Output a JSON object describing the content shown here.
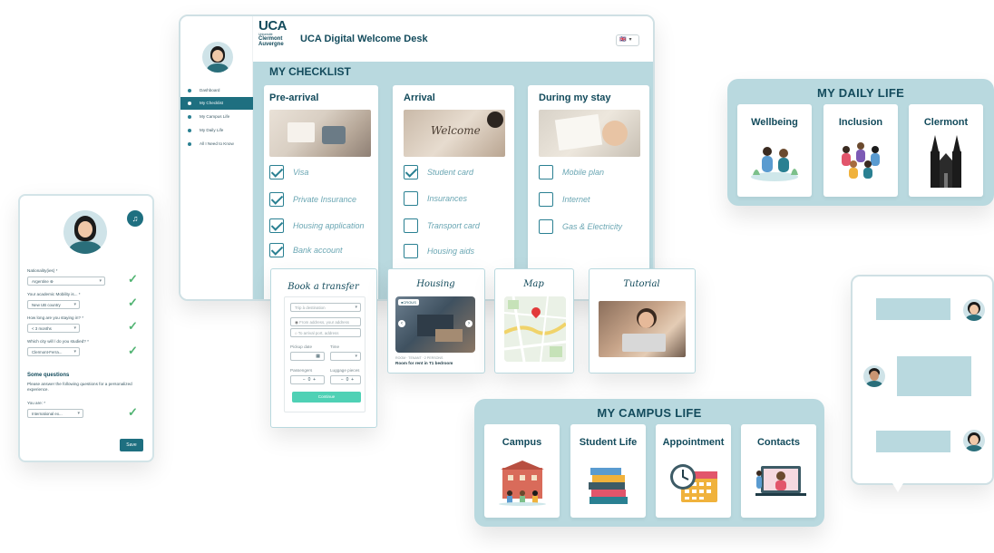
{
  "header": {
    "logo_text": "UCA",
    "logo_sub": [
      "Université",
      "Clermont",
      "Auvergne"
    ],
    "title": "UCA Digital Welcome Desk",
    "language": "🇬🇧"
  },
  "sidebar": {
    "items": [
      {
        "label": "Dashboard",
        "active": false
      },
      {
        "label": "My Checklist",
        "active": true
      },
      {
        "label": "My Campus Life",
        "active": false
      },
      {
        "label": "My Daily Life",
        "active": false
      },
      {
        "label": "All I Need to Know",
        "active": false
      }
    ]
  },
  "checklist": {
    "heading": "MY CHECKLIST",
    "columns": [
      {
        "title": "Pre-arrival",
        "items": [
          {
            "label": "Visa",
            "checked": true
          },
          {
            "label": "Private Insurance",
            "checked": true
          },
          {
            "label": "Housing application",
            "checked": true
          },
          {
            "label": "Bank account",
            "checked": true
          }
        ]
      },
      {
        "title": "Arrival",
        "image_text": "Welcome",
        "items": [
          {
            "label": "Student card",
            "checked": true
          },
          {
            "label": "Insurances",
            "checked": false
          },
          {
            "label": "Transport card",
            "checked": false
          },
          {
            "label": "Housing aids",
            "checked": false
          }
        ]
      },
      {
        "title": "During my stay",
        "items": [
          {
            "label": "Mobile plan",
            "checked": false
          },
          {
            "label": "Internet",
            "checked": false
          },
          {
            "label": "Gas & Electricity",
            "checked": false
          }
        ]
      }
    ]
  },
  "tools": {
    "book_transfer": {
      "title": "Book a transfer",
      "trip_placeholder": "Trip à destination",
      "from_placeholder": "From address, your address",
      "to_placeholder": "To arrival port, address",
      "pickup_date_label": "Pickup date",
      "time_label": "Time",
      "passengers_label": "Passengers",
      "luggage_label": "Luggage pieces",
      "continue_label": "Continue"
    },
    "housing": {
      "title": "Housing",
      "badge": "●CROUS",
      "caption_small": "ROOM · TENANT · 2 PERSONS",
      "caption": "Room for rent in T1 bedroom"
    },
    "map": {
      "title": "Map"
    },
    "tutorial": {
      "title": "Tutorial"
    }
  },
  "daily_life": {
    "heading": "MY DAILY LIFE",
    "cards": [
      {
        "title": "Wellbeing"
      },
      {
        "title": "Inclusion"
      },
      {
        "title": "Clermont"
      }
    ]
  },
  "campus_life": {
    "heading": "MY CAMPUS LIFE",
    "cards": [
      {
        "title": "Campus"
      },
      {
        "title": "Student Life"
      },
      {
        "title": "Appointment"
      },
      {
        "title": "Contacts"
      }
    ]
  },
  "mobile_form": {
    "fields": [
      {
        "label": "Nationality(ies) *",
        "value": "Argentine ⊗"
      },
      {
        "label": "Your academic Mobility is... *",
        "value": "New UB country"
      },
      {
        "label": "How long are you staying in? *",
        "value": "< 3 months"
      },
      {
        "label": "Which city will / do you studied? *",
        "value": "Clermont-Ferra..."
      }
    ],
    "section_title": "Some questions",
    "section_desc": "Please answer the following questions for a personalized experience.",
    "status_label": "You are: *",
    "status_value": "International ex...",
    "save_label": "Save"
  },
  "colors": {
    "brand": "#134b5c",
    "accent": "#2a8092",
    "panel_bg": "#b9d9df",
    "success": "#52b473",
    "cta": "#4fd1b5"
  }
}
